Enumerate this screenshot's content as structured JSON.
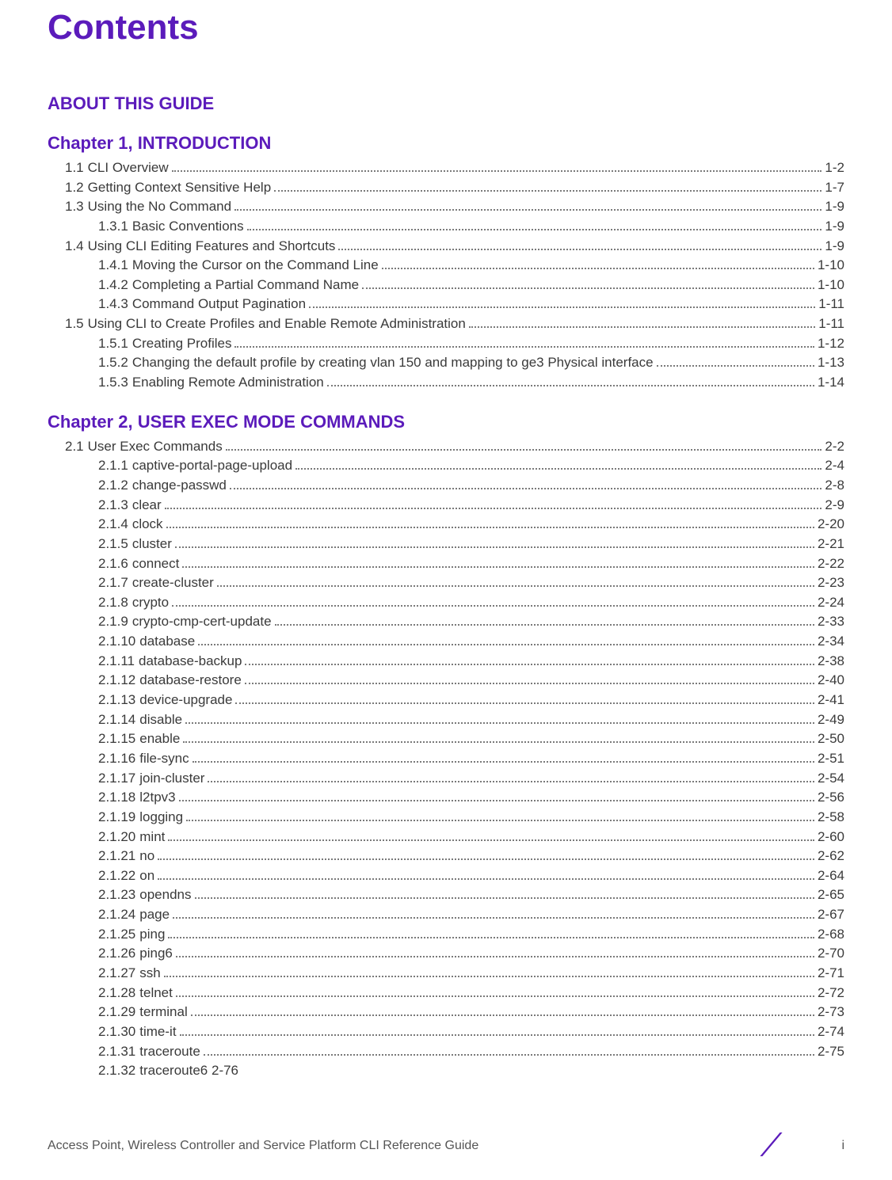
{
  "title": "Contents",
  "sections": [
    {
      "type": "section",
      "label": "ABOUT THIS GUIDE"
    },
    {
      "type": "chapter",
      "label": "Chapter 1, INTRODUCTION",
      "items": [
        {
          "level": 0,
          "num": "1.1",
          "title": "CLI Overview",
          "page": "1-2"
        },
        {
          "level": 0,
          "num": "1.2",
          "title": "Getting Context Sensitive Help",
          "page": "1-7"
        },
        {
          "level": 0,
          "num": "1.3",
          "title": "Using the No Command",
          "page": "1-9"
        },
        {
          "level": 1,
          "num": "1.3.1",
          "title": "Basic Conventions",
          "page": "1-9"
        },
        {
          "level": 0,
          "num": "1.4",
          "title": "Using CLI Editing Features and Shortcuts",
          "page": "1-9"
        },
        {
          "level": 1,
          "num": "1.4.1",
          "title": "Moving the Cursor on the Command Line",
          "page": "1-10"
        },
        {
          "level": 1,
          "num": "1.4.2",
          "title": "Completing a Partial Command Name",
          "page": "1-10"
        },
        {
          "level": 1,
          "num": "1.4.3",
          "title": "Command Output Pagination",
          "page": "1-11"
        },
        {
          "level": 0,
          "num": "1.5",
          "title": "Using CLI to Create Profiles and Enable Remote Administration",
          "page": "1-11"
        },
        {
          "level": 1,
          "num": "1.5.1",
          "title": "Creating Profiles",
          "page": "1-12"
        },
        {
          "level": 1,
          "num": "1.5.2",
          "title": "Changing the default profile by creating vlan 150 and mapping to ge3 Physical interface",
          "page": "1-13"
        },
        {
          "level": 1,
          "num": "1.5.3",
          "title": "Enabling Remote Administration",
          "page": "1-14"
        }
      ]
    },
    {
      "type": "chapter",
      "label": "Chapter 2, USER EXEC MODE COMMANDS",
      "items": [
        {
          "level": 0,
          "num": "2.1",
          "title": "User Exec Commands",
          "page": "2-2"
        },
        {
          "level": 1,
          "num": "2.1.1",
          "title": "captive-portal-page-upload",
          "page": "2-4"
        },
        {
          "level": 1,
          "num": "2.1.2",
          "title": "change-passwd",
          "page": "2-8"
        },
        {
          "level": 1,
          "num": "2.1.3",
          "title": "clear",
          "page": "2-9"
        },
        {
          "level": 1,
          "num": "2.1.4",
          "title": "clock",
          "page": "2-20"
        },
        {
          "level": 1,
          "num": "2.1.5",
          "title": "cluster",
          "page": "2-21"
        },
        {
          "level": 1,
          "num": "2.1.6",
          "title": "connect",
          "page": "2-22"
        },
        {
          "level": 1,
          "num": "2.1.7",
          "title": "create-cluster",
          "page": "2-23"
        },
        {
          "level": 1,
          "num": "2.1.8",
          "title": "crypto",
          "page": "2-24"
        },
        {
          "level": 1,
          "num": "2.1.9",
          "title": "crypto-cmp-cert-update",
          "page": "2-33"
        },
        {
          "level": 1,
          "num": "2.1.10",
          "title": "database",
          "page": "2-34"
        },
        {
          "level": 1,
          "num": "2.1.11",
          "title": "database-backup",
          "page": "2-38"
        },
        {
          "level": 1,
          "num": "2.1.12",
          "title": "database-restore",
          "page": "2-40"
        },
        {
          "level": 1,
          "num": "2.1.13",
          "title": "device-upgrade",
          "page": "2-41"
        },
        {
          "level": 1,
          "num": "2.1.14",
          "title": "disable",
          "page": "2-49"
        },
        {
          "level": 1,
          "num": "2.1.15",
          "title": "enable",
          "page": "2-50"
        },
        {
          "level": 1,
          "num": "2.1.16",
          "title": "file-sync",
          "page": "2-51"
        },
        {
          "level": 1,
          "num": "2.1.17",
          "title": "join-cluster",
          "page": "2-54"
        },
        {
          "level": 1,
          "num": "2.1.18",
          "title": "l2tpv3",
          "page": "2-56"
        },
        {
          "level": 1,
          "num": "2.1.19",
          "title": "logging",
          "page": "2-58"
        },
        {
          "level": 1,
          "num": "2.1.20",
          "title": "mint",
          "page": "2-60"
        },
        {
          "level": 1,
          "num": "2.1.21",
          "title": "no",
          "page": "2-62"
        },
        {
          "level": 1,
          "num": "2.1.22",
          "title": "on",
          "page": "2-64"
        },
        {
          "level": 1,
          "num": "2.1.23",
          "title": "opendns",
          "page": "2-65"
        },
        {
          "level": 1,
          "num": "2.1.24",
          "title": "page",
          "page": "2-67"
        },
        {
          "level": 1,
          "num": "2.1.25",
          "title": "ping",
          "page": "2-68"
        },
        {
          "level": 1,
          "num": "2.1.26",
          "title": "ping6",
          "page": "2-70"
        },
        {
          "level": 1,
          "num": "2.1.27",
          "title": "ssh",
          "page": "2-71"
        },
        {
          "level": 1,
          "num": "2.1.28",
          "title": "telnet",
          "page": "2-72"
        },
        {
          "level": 1,
          "num": "2.1.29",
          "title": "terminal",
          "page": "2-73"
        },
        {
          "level": 1,
          "num": "2.1.30",
          "title": "time-it",
          "page": "2-74"
        },
        {
          "level": 1,
          "num": "2.1.31",
          "title": "traceroute",
          "page": "2-75"
        },
        {
          "level": 1,
          "num": "2.1.32",
          "title": "traceroute6 2-76",
          "page": "",
          "nodots": true
        }
      ]
    }
  ],
  "footer": {
    "text": "Access Point, Wireless Controller and Service Platform CLI Reference Guide",
    "page": "i"
  }
}
